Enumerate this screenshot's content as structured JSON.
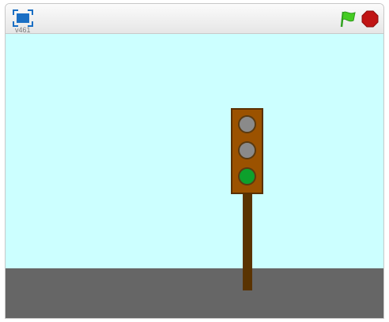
{
  "toolbar": {
    "version": "v461",
    "presentation_icon": "fullscreen-icon",
    "green_flag_icon": "green-flag-icon",
    "stop_icon": "stop-sign-icon"
  },
  "colors": {
    "sky": "#ccffff",
    "road": "#666666",
    "pole": "#5a3300",
    "housing": "#9b5200",
    "lamp_off": "#8a8a8a",
    "lamp_green": "#0da02c",
    "flag": "#44cc22",
    "stop": "#c01414"
  },
  "traffic_light": {
    "lamps": [
      "off",
      "off",
      "on"
    ]
  }
}
